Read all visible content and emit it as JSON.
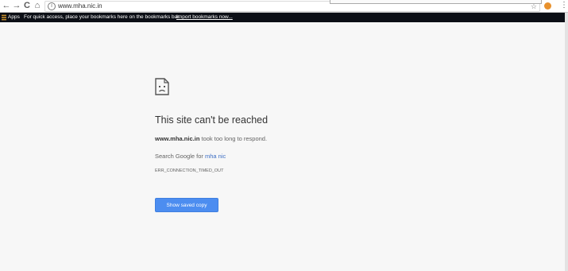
{
  "toolbar": {
    "url": "www.mha.nic.in",
    "back_glyph": "←",
    "forward_glyph": "→",
    "reload_glyph": "C",
    "home_glyph": "⌂",
    "star_glyph": "☆",
    "menu_glyph": "⋮"
  },
  "bookmarks": {
    "apps_label": "Apps",
    "prompt": "For quick access, place your bookmarks here on the bookmarks bar.",
    "import_link": "Import bookmarks now..."
  },
  "error": {
    "title": "This site can't be reached",
    "host": "www.mha.nic.in",
    "message": " took too long to respond.",
    "search_prefix": "Search Google for ",
    "search_query": "mha nic",
    "code": "ERR_CONNECTION_TIMED_OUT",
    "button_label": "Show saved copy"
  },
  "colors": {
    "page_bg": "#f7f7f7",
    "bookmarks_bg": "#0c0f16",
    "button_bg": "#4c8df0",
    "link": "#3e6fc4"
  },
  "icons": [
    "back-icon",
    "forward-icon",
    "reload-icon",
    "home-icon",
    "info-icon",
    "star-icon",
    "apps-icon",
    "sad-page-icon",
    "menu-icon"
  ]
}
